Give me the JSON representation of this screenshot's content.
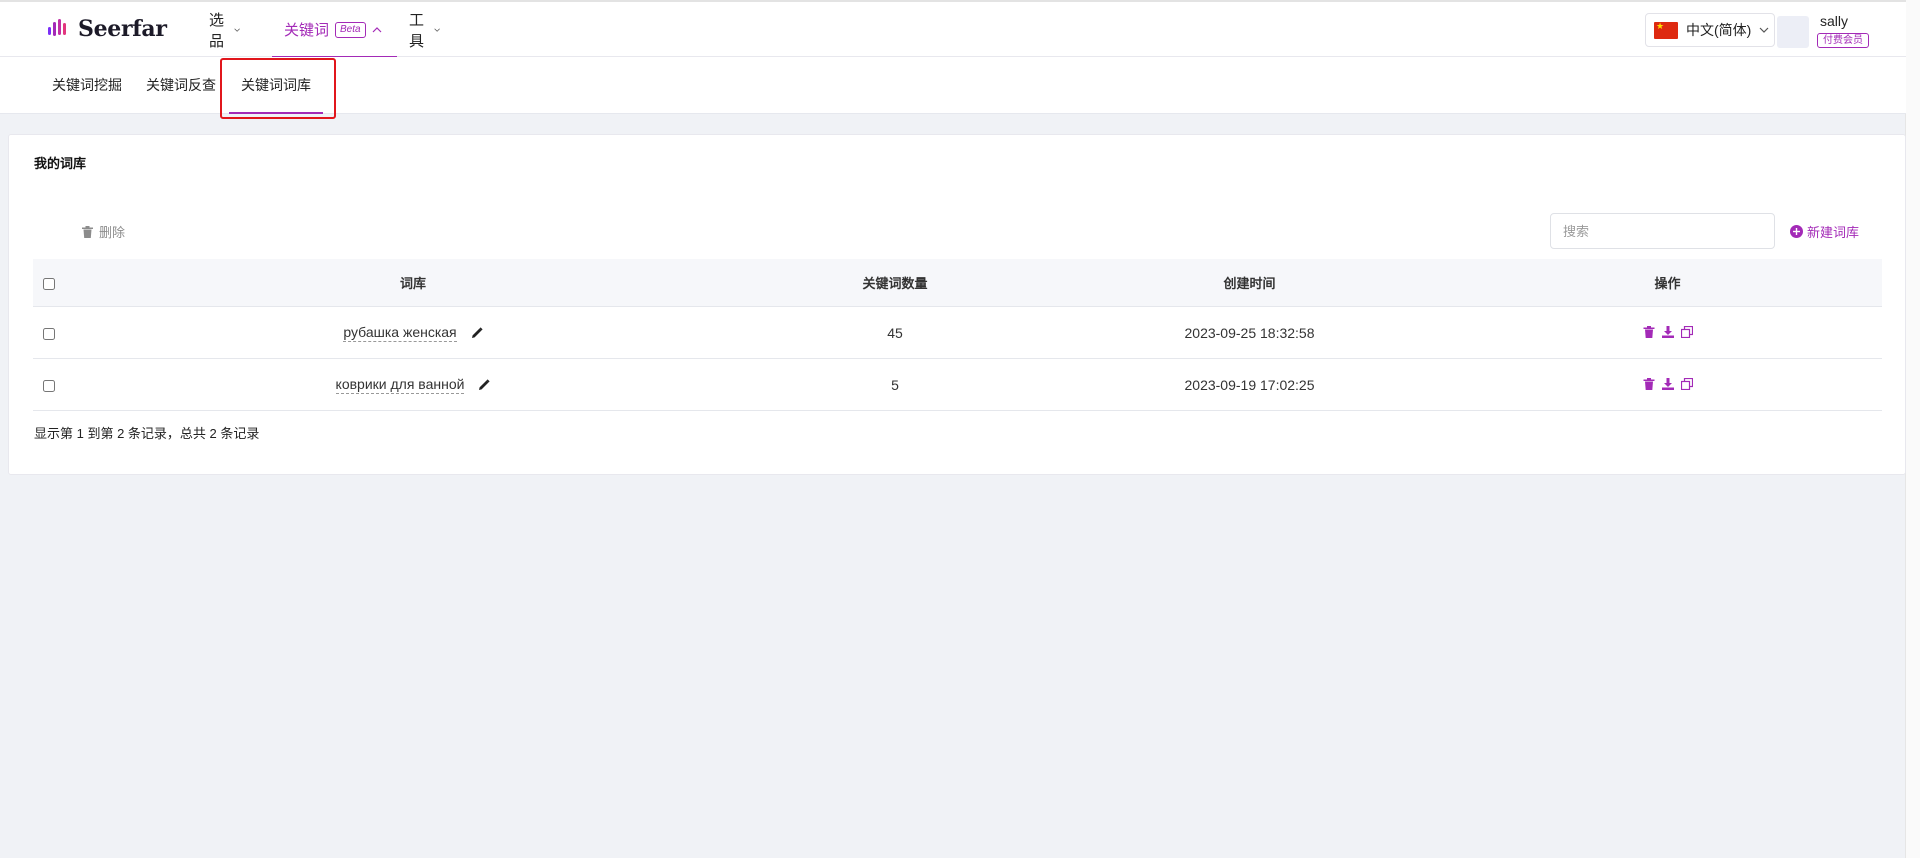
{
  "brand": {
    "name": "Seerfar",
    "accent": "#a32ab7"
  },
  "nav": {
    "items": [
      {
        "label": "选品"
      },
      {
        "label": "关键词",
        "badge": "Beta"
      },
      {
        "label": "工具"
      }
    ],
    "active_index": 1
  },
  "header": {
    "language": "中文(简体)",
    "user_name": "sally",
    "member_badge": "付费会员"
  },
  "subnav": {
    "tabs": [
      {
        "label": "关键词挖掘"
      },
      {
        "label": "关键词反查"
      },
      {
        "label": "关键词词库"
      }
    ],
    "active_index": 2
  },
  "main": {
    "card_title": "我的词库",
    "delete_label": "删除",
    "search_placeholder": "搜索",
    "new_label": "新建词库",
    "table": {
      "columns": [
        "词库",
        "关键词数量",
        "创建时间",
        "操作"
      ],
      "rows": [
        {
          "name": "рубашка женская",
          "count": "45",
          "created": "2023-09-25 18:32:58"
        },
        {
          "name": "коврики для ванной",
          "count": "5",
          "created": "2023-09-19 17:02:25"
        }
      ]
    },
    "summary": "显示第 1 到第 2 条记录，总共 2 条记录"
  },
  "icons": {
    "logo": "seerfar-logo-icon",
    "nav_chevron": "chevron-down-icon",
    "delete": "trash-icon",
    "new": "plus-circle-icon",
    "edit": "pencil-icon",
    "row_ops": [
      "trash-icon",
      "download-icon",
      "copy-icon"
    ]
  }
}
